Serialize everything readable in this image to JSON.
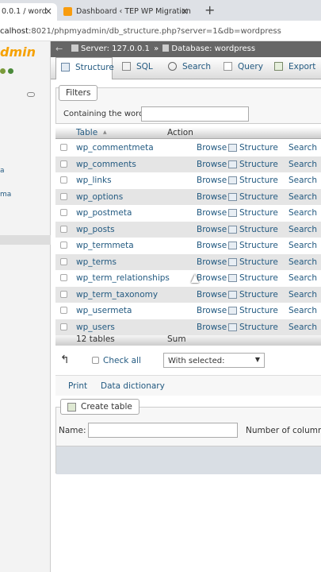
{
  "browser": {
    "tabs": [
      {
        "label": "0.0.1 / word"
      },
      {
        "label": "Dashboard ‹ TEP WP Migration —"
      }
    ],
    "address": {
      "host": "calhost",
      "path": ":8021/phpmyadmin/db_structure.php?server=1&db=wordpress"
    }
  },
  "navigation": {
    "logo": "dmin",
    "items": [
      "a",
      "ma"
    ]
  },
  "breadcrumb": {
    "server": "Server: 127.0.0.1",
    "separator": "»",
    "database": "Database: wordpress"
  },
  "menu": {
    "tabs": [
      {
        "label": "Structure"
      },
      {
        "label": "SQL"
      },
      {
        "label": "Search"
      },
      {
        "label": "Query"
      },
      {
        "label": "Export"
      }
    ]
  },
  "filters": {
    "legend": "Filters",
    "label": "Containing the word:",
    "value": ""
  },
  "table": {
    "headers": {
      "table": "Table",
      "sort": "▲",
      "action": "Action"
    },
    "action_labels": {
      "browse": "Browse",
      "structure": "Structure",
      "search": "Search"
    },
    "rows": [
      {
        "name": "wp_commentmeta"
      },
      {
        "name": "wp_comments"
      },
      {
        "name": "wp_links"
      },
      {
        "name": "wp_options"
      },
      {
        "name": "wp_postmeta"
      },
      {
        "name": "wp_posts"
      },
      {
        "name": "wp_termmeta"
      },
      {
        "name": "wp_terms"
      },
      {
        "name": "wp_term_relationships"
      },
      {
        "name": "wp_term_taxonomy"
      },
      {
        "name": "wp_usermeta"
      },
      {
        "name": "wp_users"
      }
    ],
    "footer": {
      "count": "12 tables",
      "sum": "Sum"
    }
  },
  "bulk": {
    "check_all": "Check all",
    "with_selected": "With selected:"
  },
  "links": {
    "print": "Print",
    "data_dictionary": "Data dictionary"
  },
  "create_table": {
    "legend": "Create table",
    "name_label": "Name:",
    "name_value": "",
    "columns_label": "Number of columns:"
  }
}
